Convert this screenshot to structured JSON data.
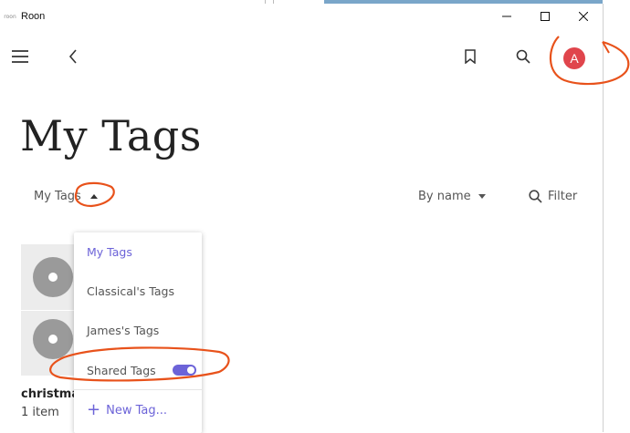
{
  "window": {
    "title": "Roon",
    "app_icon_text": "roon"
  },
  "toolbar": {
    "menu_icon": "hamburger-icon",
    "back_icon": "chevron-left-icon",
    "bookmark_icon": "bookmark-icon",
    "search_icon": "search-icon",
    "avatar_initial": "A",
    "avatar_color": "#e0454c"
  },
  "page": {
    "title": "My Tags"
  },
  "filters": {
    "tags_selector": "My Tags",
    "sort_label": "By name",
    "filter_label": "Filter"
  },
  "tiles": [
    {
      "name": "christmas",
      "count": "1 item"
    }
  ],
  "dropdown": {
    "items": [
      {
        "label": "My Tags",
        "active": true
      },
      {
        "label": "Classical's Tags",
        "active": false
      },
      {
        "label": "James's Tags",
        "active": false
      },
      {
        "label": "Shared Tags",
        "active": false,
        "toggle": true
      }
    ],
    "new_tag_label": "New Tag..."
  },
  "colors": {
    "accent": "#6c63d8",
    "annotation": "#e8521b"
  }
}
